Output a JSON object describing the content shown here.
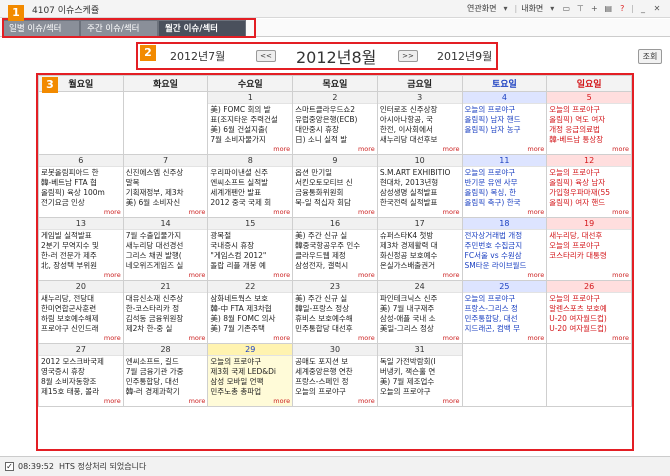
{
  "window": {
    "title": "4107 이슈스케쥴",
    "menu_linked": "연관화면",
    "menu_mine": "내화면",
    "toolbar_icons": [
      "monitor-icon",
      "pin-icon",
      "plus-icon",
      "print-icon",
      "help-icon",
      "minimize-icon",
      "close-icon"
    ]
  },
  "tabs": [
    {
      "label": "일별 이슈/섹터"
    },
    {
      "label": "주간 이슈/섹터"
    },
    {
      "label": "월간 이슈/섹터"
    }
  ],
  "badges": [
    "1",
    "2",
    "3"
  ],
  "month_nav": {
    "prev_month": "2012년7월",
    "current_month": "2012년8월",
    "next_month": "2012년9월",
    "prev_btn": "<<",
    "next_btn": ">>",
    "search_btn": "조회"
  },
  "weekdays": [
    "월요일",
    "화요일",
    "수요일",
    "목요일",
    "금요일",
    "토요일",
    "일요일"
  ],
  "weeks": [
    [
      {
        "day": "",
        "events": []
      },
      {
        "day": "",
        "events": []
      },
      {
        "day": "1",
        "events": [
          "美) FOMC 회의 발",
          "표(조지타운 주력건설",
          "美) 6월 건설지출(",
          "7월 소비자물가지"
        ],
        "more": "more"
      },
      {
        "day": "2",
        "events": [
          "스마트클라우드쇼2",
          "유럽중앙은행(ECB)",
          "대만중시 휴장",
          "日) 소니 실적 발"
        ],
        "more": "more"
      },
      {
        "day": "3",
        "events": [
          "인터로조 신주상장",
          "아시아나항공, 국",
          "한전, 이사회에서",
          "새누리당 대선후보"
        ],
        "more": "more"
      },
      {
        "day": "4",
        "events": [
          "오늘의 프로야구",
          "올림픽) 남자 핸드",
          "올림픽) 남자 농구"
        ],
        "more": "more"
      },
      {
        "day": "5",
        "events": [
          "오늘의 프로야구",
          "올림픽) 역도 여자",
          "개정 응급의료법",
          "韓-베트남 통상장"
        ],
        "more": "more"
      }
    ],
    [
      {
        "day": "6",
        "events": [
          "로봇올림피아드 한",
          "韓-베트남 FTA 협",
          "올림픽) 육상 100m",
          "전기요금 인상"
        ],
        "more": "more"
      },
      {
        "day": "7",
        "events": [
          "신진에스엠 신주상",
          "말복",
          "기획재정부, 제3차",
          "美) 6월 소비자신"
        ],
        "more": "more"
      },
      {
        "day": "8",
        "events": [
          "우리파이낸셜 신주",
          "엔씨소프트 실적발",
          "세계개펜안 발표",
          "2012 중국 국제 회"
        ],
        "more": "more"
      },
      {
        "day": "9",
        "events": [
          "옵션 만기일",
          "서킨오토모티브 신",
          "금융통화위원회",
          "북-일 적십자 회담"
        ],
        "more": "more"
      },
      {
        "day": "10",
        "events": [
          "S.M.ART EXHIBITIO",
          "현대차, 2013년형",
          "삼성생명 실적발표",
          "한국전력 실적발표"
        ],
        "more": "more"
      },
      {
        "day": "11",
        "events": [
          "오늘의 프로야구",
          "반기문 유엔 사무",
          "올림픽) 복싱, 한",
          "올림픽 축구) 한국"
        ],
        "more": "more"
      },
      {
        "day": "12",
        "events": [
          "오늘의 프로야구",
          "올림픽) 육상 남자",
          "가입형우파마재(55",
          "올림픽) 여자 핸드"
        ],
        "more": "more"
      }
    ],
    [
      {
        "day": "13",
        "events": [
          "게임빌 실적발표",
          "2분기 무역지수 및",
          "한-러 전문가 제주",
          "北, 장성택 부위원"
        ],
        "more": "more"
      },
      {
        "day": "14",
        "events": [
          "7월 수출입물가지",
          "새누리당 대선경선",
          "그리스 채권 발행(",
          "네오위즈게임즈 실"
        ],
        "more": "more"
      },
      {
        "day": "15",
        "events": [
          "광복절",
          "국내증시 휴장",
          "\"게임스컴 2012\"",
          "돌랍 리플 개봉 예"
        ],
        "more": "more"
      },
      {
        "day": "16",
        "events": [
          "美) 주간 신규 실",
          "韓중국항공우주 인수",
          "클라우드웹 제정",
          "삼성전자, 갤럭시"
        ],
        "more": "more"
      },
      {
        "day": "17",
        "events": [
          "슈퍼스타K4 첫방",
          "제3차 경제활력 대",
          "화신정공 보호예수",
          "온실가스배출권거"
        ],
        "more": "more"
      },
      {
        "day": "18",
        "events": [
          "전자상거래법 개정",
          "주민번호 수집금지",
          "FC서울 vs 수원삼",
          "SM타운 라이브월드"
        ],
        "more": "more"
      },
      {
        "day": "19",
        "events": [
          "새누리당, 대선후",
          "오늘의 프로야구",
          "코스타리카 대통령"
        ],
        "more": "more"
      }
    ],
    [
      {
        "day": "20",
        "events": [
          "새누리당, 전당대",
          "한미연합군사훈련",
          "하림 보호예수해제",
          "프로야구 신인드래"
        ],
        "more": "more"
      },
      {
        "day": "21",
        "events": [
          "대유신소재 신주상",
          "한-코스타리카 정",
          "김석동 금융위원장",
          "제2차 한-중 실"
        ],
        "more": "more"
      },
      {
        "day": "22",
        "events": [
          "삼화네트웍스 보호",
          "韓-中 FTA 제3차협",
          "美) 8월 FOMC 의사",
          "美) 7월 기존주택"
        ],
        "more": "more"
      },
      {
        "day": "23",
        "events": [
          "美) 주간 신규 실",
          "韓일-프랑스 정상",
          "휴비스 보호예수해",
          "민주통합당 대선후"
        ],
        "more": "more"
      },
      {
        "day": "24",
        "events": [
          "파인테크닉스 신주",
          "美) 7월 내구재주",
          "삼성-애플 국내 소",
          "美일-그리스 정상"
        ],
        "more": "more"
      },
      {
        "day": "25",
        "events": [
          "오늘의 프로야구",
          "프랑스-그리스 정",
          "민주통합당, 대선",
          "지드래곤, 컴백 무"
        ],
        "more": "more"
      },
      {
        "day": "26",
        "events": [
          "오늘의 프로야구",
          "알렌스포츠 보호예",
          "U-20 여자월드컵)",
          "U-20 여자월드컵)"
        ],
        "more": "more"
      }
    ],
    [
      {
        "day": "27",
        "events": [
          "2012 모스크바국제",
          "영국증시 휴장",
          "8월 소비자동향조",
          "제15호 태풍, 볼라"
        ],
        "more": "more"
      },
      {
        "day": "28",
        "events": [
          "엔씨소프트, 길드",
          "7월 금융기관 가중",
          "민주통합당, 대선",
          "韓-러 경제과학기"
        ],
        "more": "more"
      },
      {
        "day": "29",
        "today": true,
        "events": [
          "오늘의 프로야구",
          "제3회 국제 LED&Di",
          "삼성 모바일 언팩",
          "민주노총 총파업"
        ],
        "more": "more"
      },
      {
        "day": "30",
        "events": [
          "공매도 포지션 보",
          "세계중앙은행 연찬",
          "프랑스-스페인 정",
          "오늘의 프로야구"
        ],
        "more": "more"
      },
      {
        "day": "31",
        "events": [
          "독일 가전박람회(I",
          "버냉키, 잭슨홀 연",
          "美) 7월 제조업수",
          "오늘의 프로야구"
        ],
        "more": "more"
      },
      {
        "day": "",
        "events": []
      },
      {
        "day": "",
        "events": []
      }
    ]
  ],
  "status": {
    "time": "08:39:52",
    "message": "HTS 정상처리 되었습니다"
  }
}
